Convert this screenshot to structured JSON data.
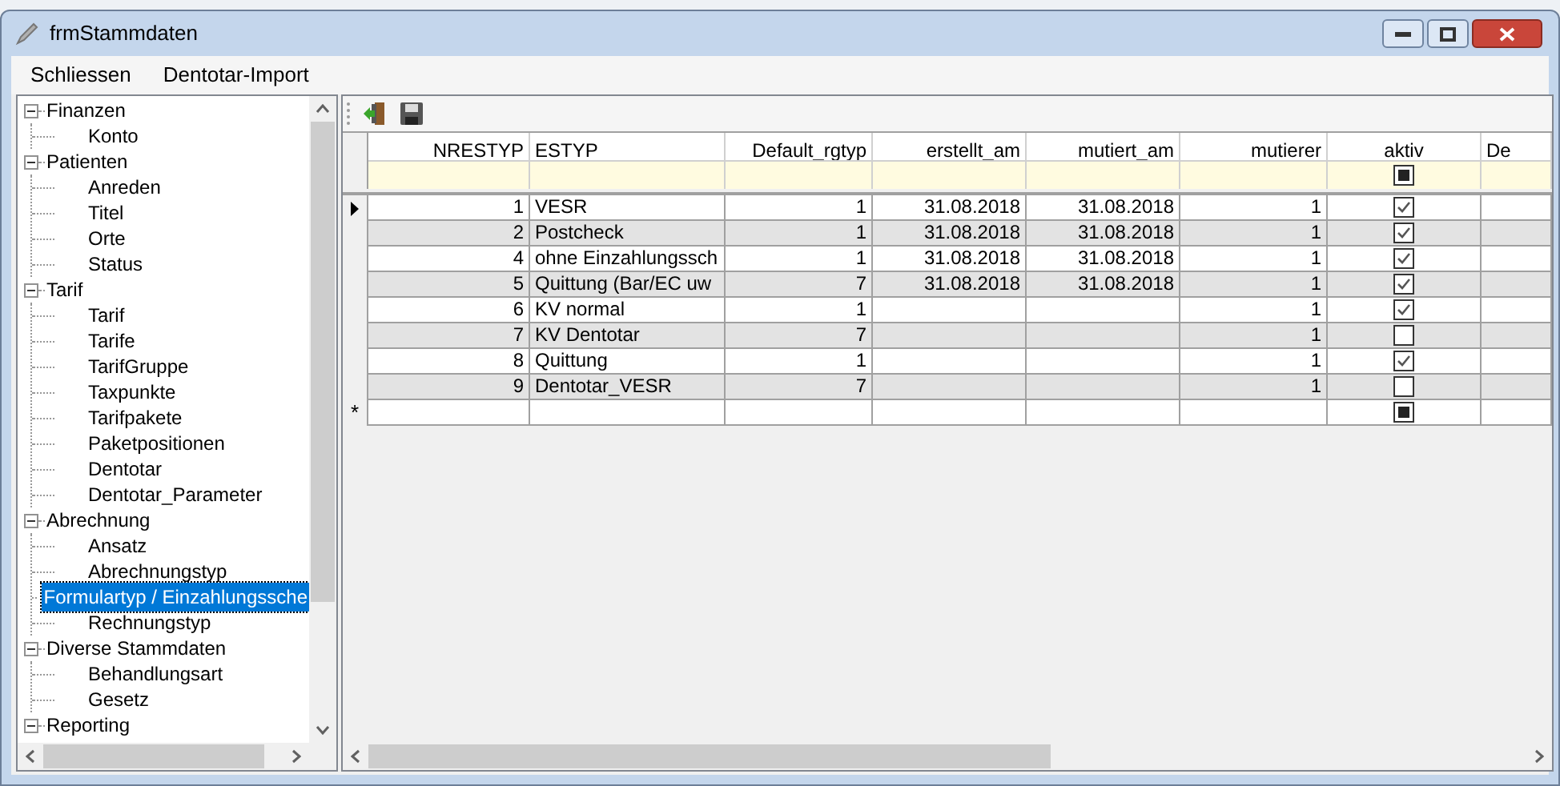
{
  "window": {
    "title": "frmStammdaten"
  },
  "menu": [
    "Schliessen",
    "Dentotar-Import"
  ],
  "tree": [
    {
      "label": "Finanzen",
      "expanded": true,
      "selected": false,
      "children": [
        {
          "label": "Konto",
          "selected": false
        }
      ]
    },
    {
      "label": "Patienten",
      "expanded": true,
      "selected": false,
      "children": [
        {
          "label": "Anreden",
          "selected": false
        },
        {
          "label": "Titel",
          "selected": false
        },
        {
          "label": "Orte",
          "selected": false
        },
        {
          "label": "Status",
          "selected": false
        }
      ]
    },
    {
      "label": "Tarif",
      "expanded": true,
      "selected": false,
      "children": [
        {
          "label": "Tarif",
          "selected": false
        },
        {
          "label": "Tarife",
          "selected": false
        },
        {
          "label": "TarifGruppe",
          "selected": false
        },
        {
          "label": "Taxpunkte",
          "selected": false
        },
        {
          "label": "Tarifpakete",
          "selected": false
        },
        {
          "label": "Paketpositionen",
          "selected": false
        },
        {
          "label": "Dentotar",
          "selected": false
        },
        {
          "label": "Dentotar_Parameter",
          "selected": false
        }
      ]
    },
    {
      "label": "Abrechnung",
      "expanded": true,
      "selected": false,
      "children": [
        {
          "label": "Ansatz",
          "selected": false
        },
        {
          "label": "Abrechnungstyp",
          "selected": false
        },
        {
          "label": "Formulartyp / Einzahlungssche",
          "selected": true
        },
        {
          "label": "Rechnungstyp",
          "selected": false
        }
      ]
    },
    {
      "label": "Diverse Stammdaten",
      "expanded": true,
      "selected": false,
      "children": [
        {
          "label": "Behandlungsart",
          "selected": false
        },
        {
          "label": "Gesetz",
          "selected": false
        }
      ]
    },
    {
      "label": "Reporting",
      "expanded": true,
      "selected": false
    }
  ],
  "table": {
    "columns": [
      "NRESTYP",
      "ESTYP",
      "Default_rgtyp",
      "erstellt_am",
      "mutiert_am",
      "mutierer",
      "aktiv",
      "De"
    ],
    "filter_row": {
      "aktiv_indeterminate": true
    },
    "rows": [
      {
        "cells": [
          "1",
          "VESR",
          "1",
          "31.08.2018",
          "31.08.2018",
          "1"
        ],
        "aktiv": true,
        "current": true
      },
      {
        "cells": [
          "2",
          "Postcheck",
          "1",
          "31.08.2018",
          "31.08.2018",
          "1"
        ],
        "aktiv": true,
        "current": false
      },
      {
        "cells": [
          "4",
          "ohne Einzahlungssch",
          "1",
          "31.08.2018",
          "31.08.2018",
          "1"
        ],
        "aktiv": true,
        "current": false
      },
      {
        "cells": [
          "5",
          "Quittung (Bar/EC uw",
          "7",
          "31.08.2018",
          "31.08.2018",
          "1"
        ],
        "aktiv": true,
        "current": false
      },
      {
        "cells": [
          "6",
          "KV normal",
          "1",
          "",
          "",
          "1"
        ],
        "aktiv": true,
        "current": false
      },
      {
        "cells": [
          "7",
          "KV Dentotar",
          "7",
          "",
          "",
          "1"
        ],
        "aktiv": false,
        "current": false
      },
      {
        "cells": [
          "8",
          "Quittung",
          "1",
          "",
          "",
          "1"
        ],
        "aktiv": true,
        "current": false
      },
      {
        "cells": [
          "9",
          "Dentotar_VESR",
          "7",
          "",
          "",
          "1"
        ],
        "aktiv": false,
        "current": false
      }
    ],
    "new_row": {
      "marker": "*",
      "aktiv_indeterminate": true
    }
  }
}
